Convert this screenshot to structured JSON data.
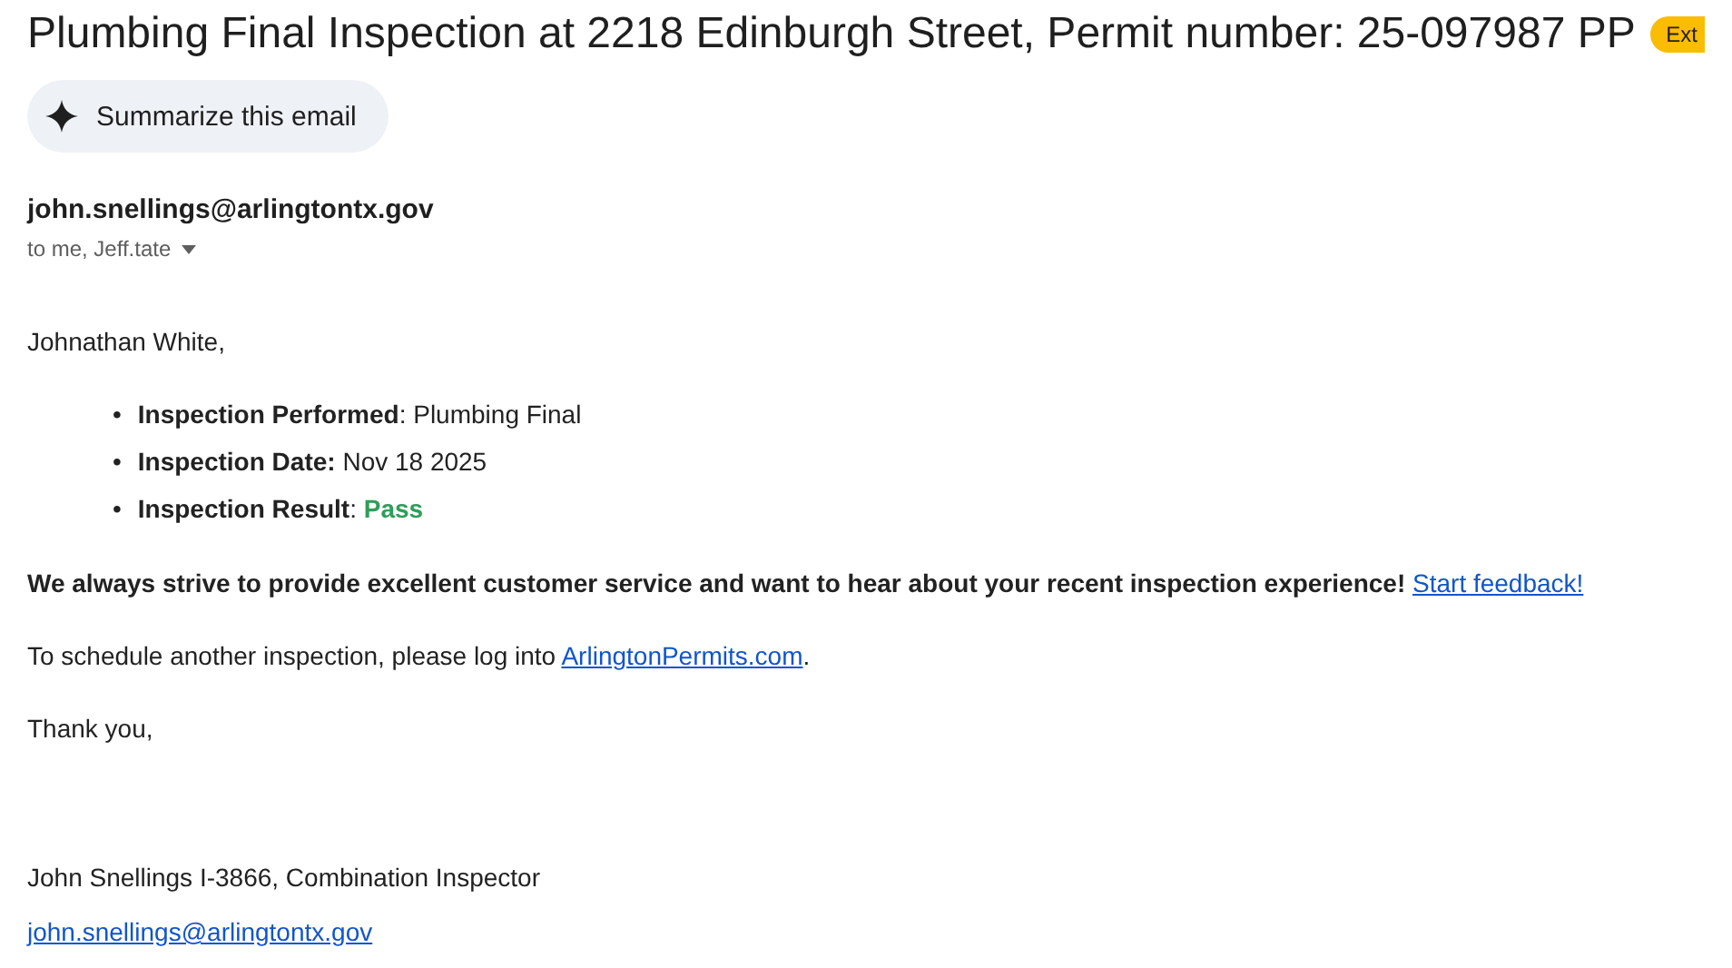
{
  "subject": "Plumbing Final Inspection at 2218 Edinburgh Street, Permit number: 25-097987 PP",
  "badge": "Ext",
  "summarize_button": "Summarize this email",
  "sender": "john.snellings@arlingtontx.gov",
  "recipients": "to me, Jeff.tate",
  "greeting": "Johnathan White,",
  "details": [
    {
      "marker": "•",
      "label": "Inspection Performed",
      "separator": ":",
      "value": " Plumbing Final"
    },
    {
      "marker": "•",
      "label": "Inspection Date:",
      "value": " Nov 18 2025"
    },
    {
      "marker": "•",
      "label": "Inspection Result",
      "separator": ":",
      "value": " Pass",
      "color": "#2e9e5b"
    }
  ],
  "feedback": {
    "text": "We always strive to provide excellent customer service and want to hear about your recent inspection experience!",
    "link": "Start feedback!"
  },
  "schedule": {
    "text": "To schedule another inspection, please log into ",
    "link": "ArlingtonPermits.com",
    "after": "."
  },
  "closing": "Thank you,",
  "signature": "John Snellings I-3866, Combination Inspector",
  "signature_email": "john.snellings@arlingtontx.gov"
}
